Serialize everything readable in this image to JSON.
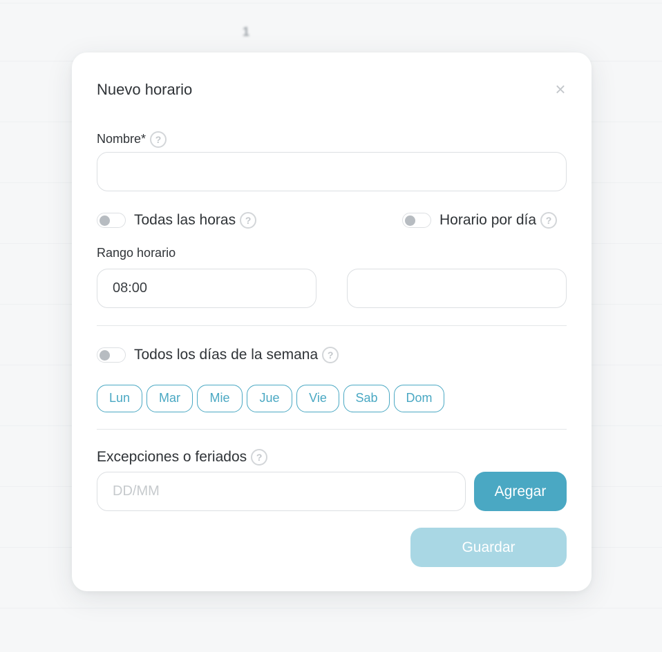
{
  "background": {
    "number": "1"
  },
  "modal": {
    "title": "Nuevo horario",
    "close_icon": "×",
    "name_field": {
      "label": "Nombre*",
      "value": "",
      "placeholder": ""
    },
    "toggle_all_hours": {
      "label": "Todas las horas",
      "on": false
    },
    "toggle_per_day": {
      "label": "Horario por día",
      "on": false
    },
    "time_range": {
      "label": "Rango horario",
      "start": "08:00",
      "end": ""
    },
    "toggle_all_days": {
      "label": "Todos los días de la semana",
      "on": false
    },
    "days": [
      "Lun",
      "Mar",
      "Mie",
      "Jue",
      "Vie",
      "Sab",
      "Dom"
    ],
    "exceptions": {
      "label": "Excepciones o feriados",
      "placeholder": "DD/MM",
      "value": "",
      "add_label": "Agregar"
    },
    "save_label": "Guardar",
    "help_icon": "?"
  },
  "colors": {
    "accent": "#4aa8c3",
    "accent_disabled": "#a9d7e4"
  }
}
